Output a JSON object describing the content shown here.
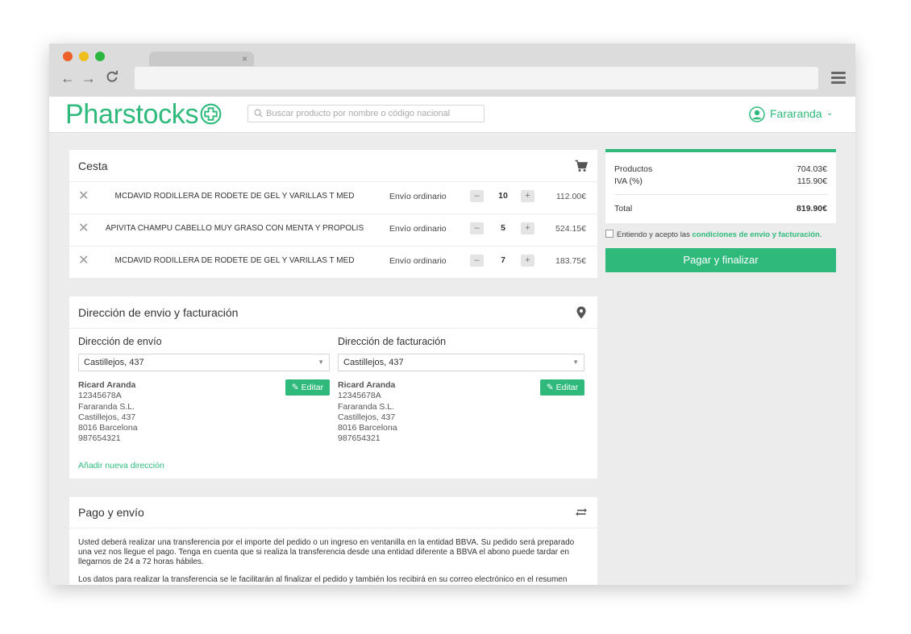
{
  "browser": {
    "tab_close": "×",
    "back": "←",
    "forward": "→",
    "reload": "C"
  },
  "header": {
    "logo": "Pharstocks",
    "search_placeholder": "Buscar producto por nombre o código nacional",
    "user_name": "Fararanda",
    "user_chevron": "⌄"
  },
  "cart": {
    "title": "Cesta",
    "remove_symbol": "✕",
    "minus_symbol": "–",
    "plus_symbol": "+",
    "items": [
      {
        "name": "MCDAVID RODILLERA DE RODETE DE GEL Y VARILLAS T MED",
        "shipping": "Envío ordinario",
        "qty": "10",
        "price": "112.00€"
      },
      {
        "name": "APIVITA CHAMPU CABELLO MUY GRASO CON MENTA Y PROPOLIS",
        "shipping": "Envío ordinario",
        "qty": "5",
        "price": "524.15€"
      },
      {
        "name": "MCDAVID RODILLERA DE RODETE DE GEL Y VARILLAS T MED",
        "shipping": "Envío ordinario",
        "qty": "7",
        "price": "183.75€"
      }
    ]
  },
  "addresses": {
    "title": "Dirección de envio y facturación",
    "shipping_label": "Dirección de envío",
    "billing_label": "Dirección de facturación",
    "shipping_selected": "Castillejos, 437",
    "billing_selected": "Castillejos, 437",
    "edit_label": "Editar",
    "add_new": "Añadir nueva dirección",
    "shipping": {
      "name": "Ricard Aranda",
      "id": "12345678A",
      "company": "Fararanda S.L.",
      "street": "Castillejos, 437",
      "city": "8016 Barcelona",
      "phone": "987654321"
    },
    "billing": {
      "name": "Ricard Aranda",
      "id": "12345678A",
      "company": "Fararanda S.L.",
      "street": "Castillejos, 437",
      "city": "8016 Barcelona",
      "phone": "987654321"
    }
  },
  "payment": {
    "title": "Pago y envío",
    "text_1": "Usted deberá realizar una transferencia por el importe del pedido o un ingreso en ventanilla en la entidad BBVA. Su pedido será preparado una vez nos llegue el pago. Tenga en cuenta que si realiza la transferencia desde una entidad diferente a BBVA el abono puede tardar en llegarnos de 24 a 72 horas hábiles.",
    "text_2": "Los datos para realizar la transferencia se le facilitarán al finalizar el pedido y también los recibirá en su correo electrónico en el resumen"
  },
  "summary": {
    "products_label": "Productos",
    "products_value": "704.03€",
    "iva_label": "IVA (%)",
    "iva_value": "115.90€",
    "total_label": "Total",
    "total_value": "819.90€",
    "terms_text": "Entiendo y acepto las",
    "terms_link": "condiciones de envio y facturación",
    "terms_end": ".",
    "pay_button": "Pagar y finalizar"
  },
  "colors": {
    "brand_green": "#2fba7c",
    "traffic_red": "#ed5f28",
    "traffic_yellow": "#f0be1b",
    "traffic_green": "#2cb63f"
  }
}
